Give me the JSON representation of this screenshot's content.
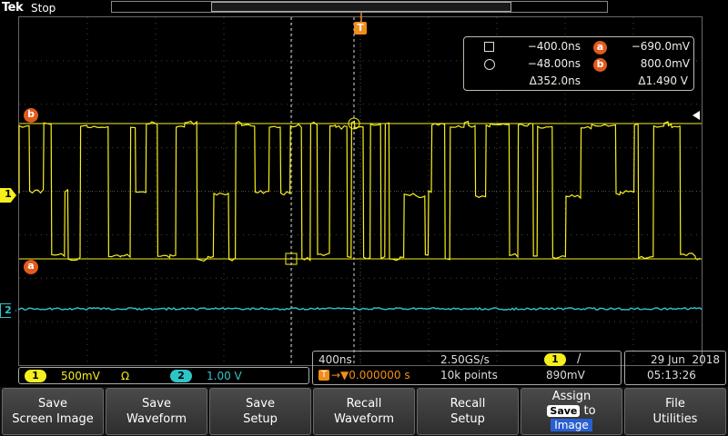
{
  "header": {
    "brand": "Tek",
    "run_state": "Stop"
  },
  "cursors": {
    "rows": [
      {
        "time": "−400.0ns",
        "badge": "a",
        "value": "−690.0mV"
      },
      {
        "time": "−48.00ns",
        "badge": "b",
        "value": "800.0mV"
      }
    ],
    "delta_time": "Δ352.0ns",
    "delta_value": "Δ1.490 V"
  },
  "markers": {
    "cursor_b": "b",
    "cursor_a": "a",
    "channel1": "1",
    "channel2": "2",
    "trigger": "T"
  },
  "vertical": {
    "ch1": {
      "label": "1",
      "scale": "500mV",
      "coupling": "Ω"
    },
    "ch2": {
      "label": "2",
      "scale": "1.00 V"
    }
  },
  "horizontal": {
    "timebase": "400ns",
    "sample_rate": "2.50GS/s",
    "trigger_symbol": "T",
    "trigger_position": "→▼0.000000 s",
    "record_length": "10k points",
    "trigger_channel": "1",
    "trigger_slope": "/",
    "trigger_level": "890mV"
  },
  "datetime": {
    "date": "29 Jun  2018",
    "time": "05:13:26"
  },
  "menu": [
    {
      "line1": "Save",
      "line2": "Screen Image"
    },
    {
      "line1": "Save",
      "line2": "Waveform"
    },
    {
      "line1": "Save",
      "line2": "Setup"
    },
    {
      "line1": "Recall",
      "line2": "Waveform"
    },
    {
      "line1": "Recall",
      "line2": "Setup"
    },
    {
      "line1": "Assign",
      "save_pill": "Save",
      "to": "to",
      "image": "Image"
    },
    {
      "line1": "File",
      "line2": "Utilities"
    }
  ],
  "colors": {
    "ch1": "#f5ef1e",
    "ch2": "#2fc4c8",
    "cursor_ref": "#e25a1c",
    "trigger": "#f28c1a"
  }
}
